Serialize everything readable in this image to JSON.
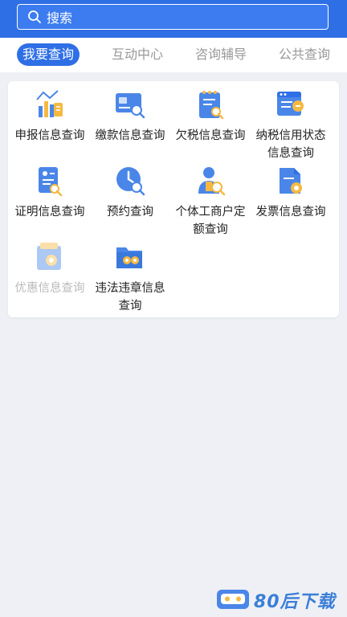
{
  "search": {
    "placeholder": "搜索"
  },
  "tabs": [
    {
      "label": "我要查询",
      "active": true
    },
    {
      "label": "互动中心",
      "active": false
    },
    {
      "label": "咨询辅导",
      "active": false
    },
    {
      "label": "公共查询",
      "active": false
    }
  ],
  "grid": [
    {
      "label": "申报信息查询",
      "icon": "bar-chart-document-icon"
    },
    {
      "label": "缴款信息查询",
      "icon": "payment-card-search-icon"
    },
    {
      "label": "欠税信息查询",
      "icon": "notepad-search-icon"
    },
    {
      "label": "纳税信用状态信息查询",
      "icon": "browser-credit-icon"
    },
    {
      "label": "证明信息查询",
      "icon": "certificate-search-icon"
    },
    {
      "label": "预约查询",
      "icon": "clock-search-icon"
    },
    {
      "label": "个体工商户定额查询",
      "icon": "person-search-icon"
    },
    {
      "label": "发票信息查询",
      "icon": "invoice-gear-icon"
    },
    {
      "label": "优惠信息查询",
      "icon": "discount-gear-icon",
      "disabled": true
    },
    {
      "label": "违法违章信息查询",
      "icon": "folder-gear-icon"
    }
  ],
  "watermark": {
    "text": "80后下载"
  },
  "colors": {
    "primary": "#2f6fe6",
    "icon_blue": "#4a86e8",
    "icon_yellow": "#f5b942",
    "background": "#eff0f5"
  }
}
